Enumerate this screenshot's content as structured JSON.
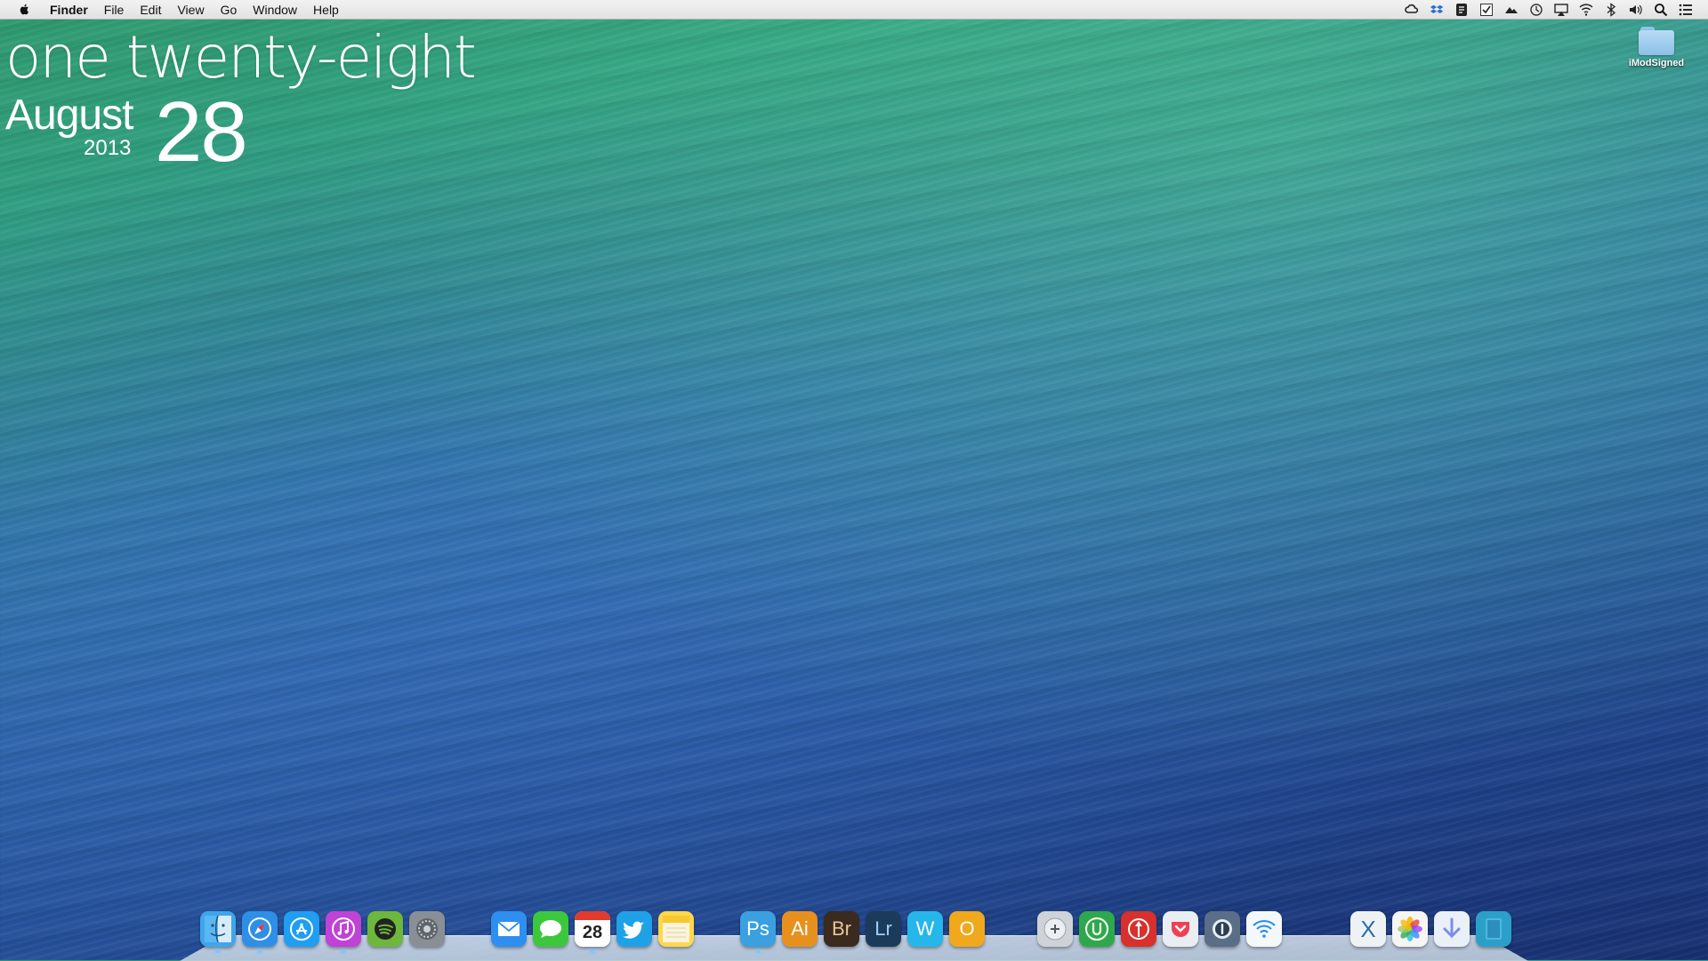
{
  "menubar": {
    "apple_icon": "apple-logo-icon",
    "app_name": "Finder",
    "items": [
      "File",
      "Edit",
      "View",
      "Go",
      "Window",
      "Help"
    ],
    "status_icons": [
      "creative-cloud-icon",
      "dropbox-icon",
      "evernote-icon",
      "tasks-checkbox-icon",
      "cloud-sync-icon",
      "time-machine-icon",
      "airplay-icon",
      "wifi-icon",
      "bluetooth-icon",
      "volume-icon",
      "spotlight-search-icon",
      "notification-center-icon"
    ]
  },
  "clock_widget": {
    "time_words": "one twenty-eight",
    "month": "August",
    "year": "2013",
    "day": "28"
  },
  "desktop": {
    "folder_label": "iModSigned"
  },
  "dock": {
    "apps": [
      {
        "name": "Finder",
        "icon": "finder-icon",
        "color": "#3ea6ec",
        "running": true
      },
      {
        "name": "Safari",
        "icon": "safari-icon",
        "color": "#2e8fe8",
        "running": true
      },
      {
        "name": "App Store",
        "icon": "app-store-icon",
        "color": "#1f9ef2",
        "running": false
      },
      {
        "name": "iTunes",
        "icon": "itunes-icon",
        "color": "#c042d6",
        "running": true
      },
      {
        "name": "Spotify",
        "icon": "spotify-icon",
        "color": "#6db73b",
        "running": false
      },
      {
        "name": "System Preferences",
        "icon": "system-preferences-icon",
        "color": "#8a8f96",
        "running": false
      },
      {
        "name": "Mail",
        "icon": "mail-icon",
        "color": "#2d8ff0",
        "running": false
      },
      {
        "name": "Messages",
        "icon": "messages-icon",
        "color": "#3cc83c",
        "running": false
      },
      {
        "name": "Calendar",
        "icon": "calendar-icon",
        "label": "28",
        "color": "#ffffff",
        "running": true
      },
      {
        "name": "Twitter",
        "icon": "twitter-icon",
        "color": "#1fa1e8",
        "running": false
      },
      {
        "name": "Notes",
        "icon": "notes-icon",
        "color": "#ffd84a",
        "running": false
      },
      {
        "name": "Photoshop",
        "icon": "photoshop-icon",
        "label": "Ps",
        "color": "#3aa0e0",
        "running": true
      },
      {
        "name": "Illustrator",
        "icon": "illustrator-icon",
        "label": "Ai",
        "color": "#e8901e",
        "running": false
      },
      {
        "name": "Bridge",
        "icon": "bridge-icon",
        "label": "Br",
        "color": "#3b2a1e",
        "running": false
      },
      {
        "name": "Lightroom",
        "icon": "lightroom-icon",
        "label": "Lr",
        "color": "#1c3a5a",
        "running": false
      },
      {
        "name": "Word",
        "icon": "word-icon",
        "label": "W",
        "color": "#25b7ea",
        "running": false
      },
      {
        "name": "Outlook",
        "icon": "outlook-icon",
        "label": "O",
        "color": "#f0a81c",
        "running": false
      },
      {
        "name": "Game Controller",
        "icon": "gamepad-icon",
        "color": "#cfd3d7",
        "running": false
      },
      {
        "name": "Evernote",
        "icon": "evernote-dock-icon",
        "color": "#2ea84b",
        "running": false
      },
      {
        "name": "Transmit",
        "icon": "transmit-icon",
        "color": "#d8302c",
        "running": false
      },
      {
        "name": "Pocket",
        "icon": "pocket-icon",
        "color": "#e9eef2",
        "running": false
      },
      {
        "name": "1Password",
        "icon": "1password-icon",
        "color": "#5a6e88",
        "running": false
      },
      {
        "name": "Wi-Fi",
        "icon": "wifi-dock-icon",
        "color": "#f4f8fb",
        "running": false
      },
      {
        "name": "Xcode",
        "icon": "xcode-icon",
        "label": "X",
        "color": "#eef2f4",
        "running": false
      },
      {
        "name": "Photos",
        "icon": "photos-icon",
        "color": "#f5f5f5",
        "running": false
      },
      {
        "name": "Downloads",
        "icon": "downloads-stack-icon",
        "color": "#e9f0f8",
        "running": false
      },
      {
        "name": "Documents",
        "icon": "documents-stack-icon",
        "color": "#2aa0c8",
        "running": false
      }
    ]
  }
}
